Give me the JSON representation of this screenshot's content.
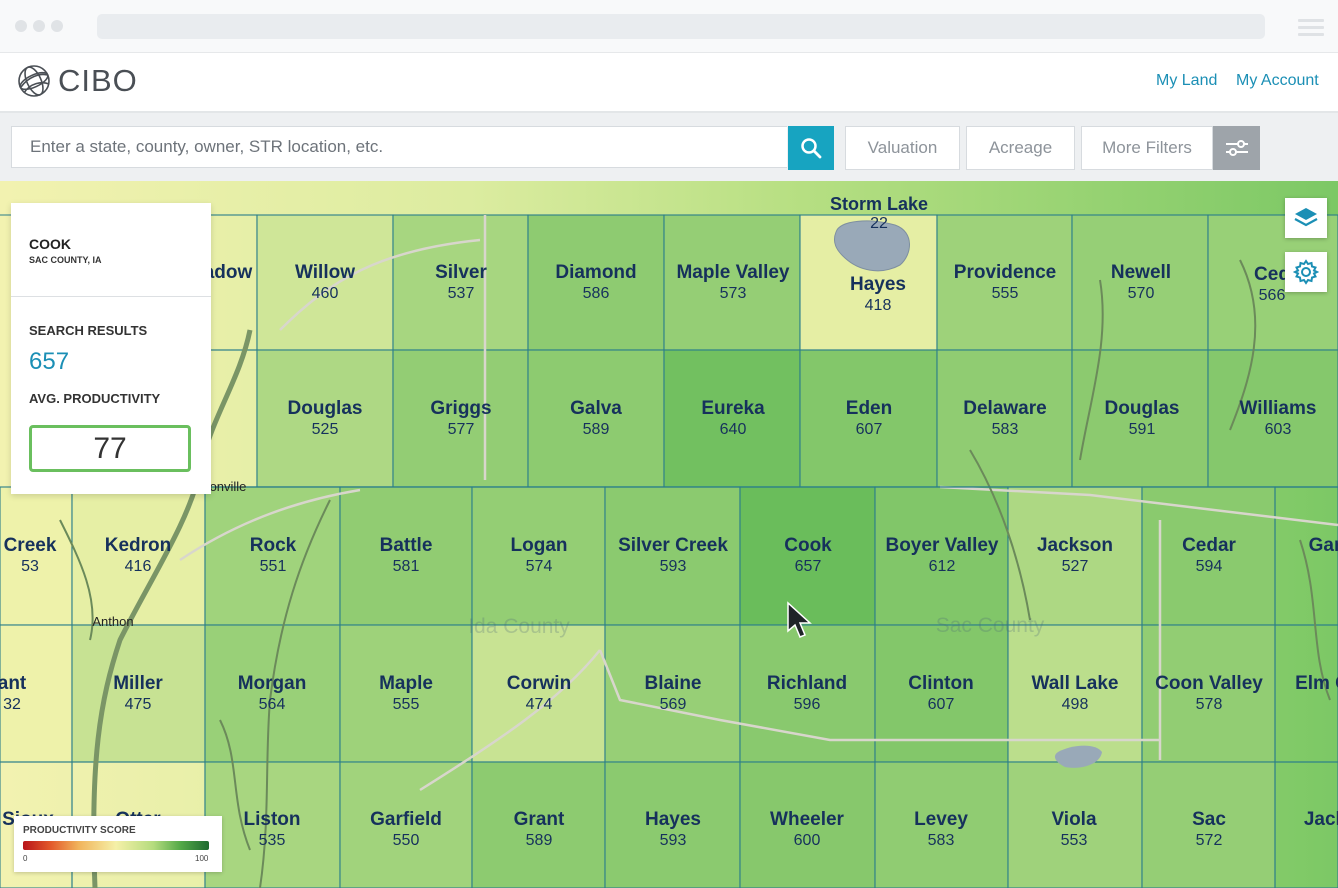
{
  "app": {
    "logo_text": "CIBO",
    "brand_color": "#1b8fb5",
    "search_button_color": "#17a4c1"
  },
  "nav": {
    "my_land": "My Land",
    "my_account": "My Account"
  },
  "search": {
    "placeholder": "Enter a state, county, owner, STR location, etc."
  },
  "filters": {
    "valuation": "Valuation",
    "acreage": "Acreage",
    "more_filters": "More Filters"
  },
  "panel": {
    "name": "COOK",
    "location": "SAC COUNTY, IA",
    "search_results_label": "SEARCH RESULTS",
    "search_results_value": "657",
    "avg_productivity_label": "AVG. PRODUCTIVITY",
    "avg_productivity_value": "77"
  },
  "legend": {
    "title": "PRODUCTIVITY SCORE",
    "min": "0",
    "max": "100"
  },
  "map": {
    "counties": [
      "Ida County",
      "Sac County"
    ],
    "towns": [
      "Storm Lake",
      "Anthon",
      "onville"
    ],
    "townships": [
      {
        "name": "adow",
        "value": ""
      },
      {
        "name": "Willow",
        "value": "460"
      },
      {
        "name": "Silver",
        "value": "537"
      },
      {
        "name": "Diamond",
        "value": "586"
      },
      {
        "name": "Maple Valley",
        "value": "573"
      },
      {
        "name": "Hayes",
        "value": "418"
      },
      {
        "name": "Providence",
        "value": "555"
      },
      {
        "name": "Newell",
        "value": "570"
      },
      {
        "name": "Ced",
        "value": "566"
      },
      {
        "name": "n",
        "value": ""
      },
      {
        "name": "Douglas",
        "value": "525"
      },
      {
        "name": "Griggs",
        "value": "577"
      },
      {
        "name": "Galva",
        "value": "589"
      },
      {
        "name": "Eureka",
        "value": "640"
      },
      {
        "name": "Eden",
        "value": "607"
      },
      {
        "name": "Delaware",
        "value": "583"
      },
      {
        "name": "Douglas",
        "value": "591"
      },
      {
        "name": "Williams",
        "value": "603"
      },
      {
        "name": "Creek",
        "value": "53"
      },
      {
        "name": "Kedron",
        "value": "416"
      },
      {
        "name": "Rock",
        "value": "551"
      },
      {
        "name": "Battle",
        "value": "581"
      },
      {
        "name": "Logan",
        "value": "574"
      },
      {
        "name": "Silver Creek",
        "value": "593"
      },
      {
        "name": "Cook",
        "value": "657"
      },
      {
        "name": "Boyer Valley",
        "value": "612"
      },
      {
        "name": "Jackson",
        "value": "527"
      },
      {
        "name": "Cedar",
        "value": "594"
      },
      {
        "name": "Gar",
        "value": ""
      },
      {
        "name": "ant",
        "value": "32"
      },
      {
        "name": "Miller",
        "value": "475"
      },
      {
        "name": "Morgan",
        "value": "564"
      },
      {
        "name": "Maple",
        "value": "555"
      },
      {
        "name": "Corwin",
        "value": "474"
      },
      {
        "name": "Blaine",
        "value": "569"
      },
      {
        "name": "Richland",
        "value": "596"
      },
      {
        "name": "Clinton",
        "value": "607"
      },
      {
        "name": "Wall Lake",
        "value": "498"
      },
      {
        "name": "Coon Valley",
        "value": "578"
      },
      {
        "name": "Elm C",
        "value": ""
      },
      {
        "name": "Sioux",
        "value": ""
      },
      {
        "name": "Otter",
        "value": ""
      },
      {
        "name": "Liston",
        "value": "535"
      },
      {
        "name": "Garfield",
        "value": "550"
      },
      {
        "name": "Grant",
        "value": "589"
      },
      {
        "name": "Hayes",
        "value": "593"
      },
      {
        "name": "Wheeler",
        "value": "600"
      },
      {
        "name": "Levey",
        "value": "583"
      },
      {
        "name": "Viola",
        "value": "553"
      },
      {
        "name": "Sac",
        "value": "572"
      },
      {
        "name": "Jack",
        "value": ""
      },
      {
        "name": "",
        "value": "22"
      }
    ]
  }
}
